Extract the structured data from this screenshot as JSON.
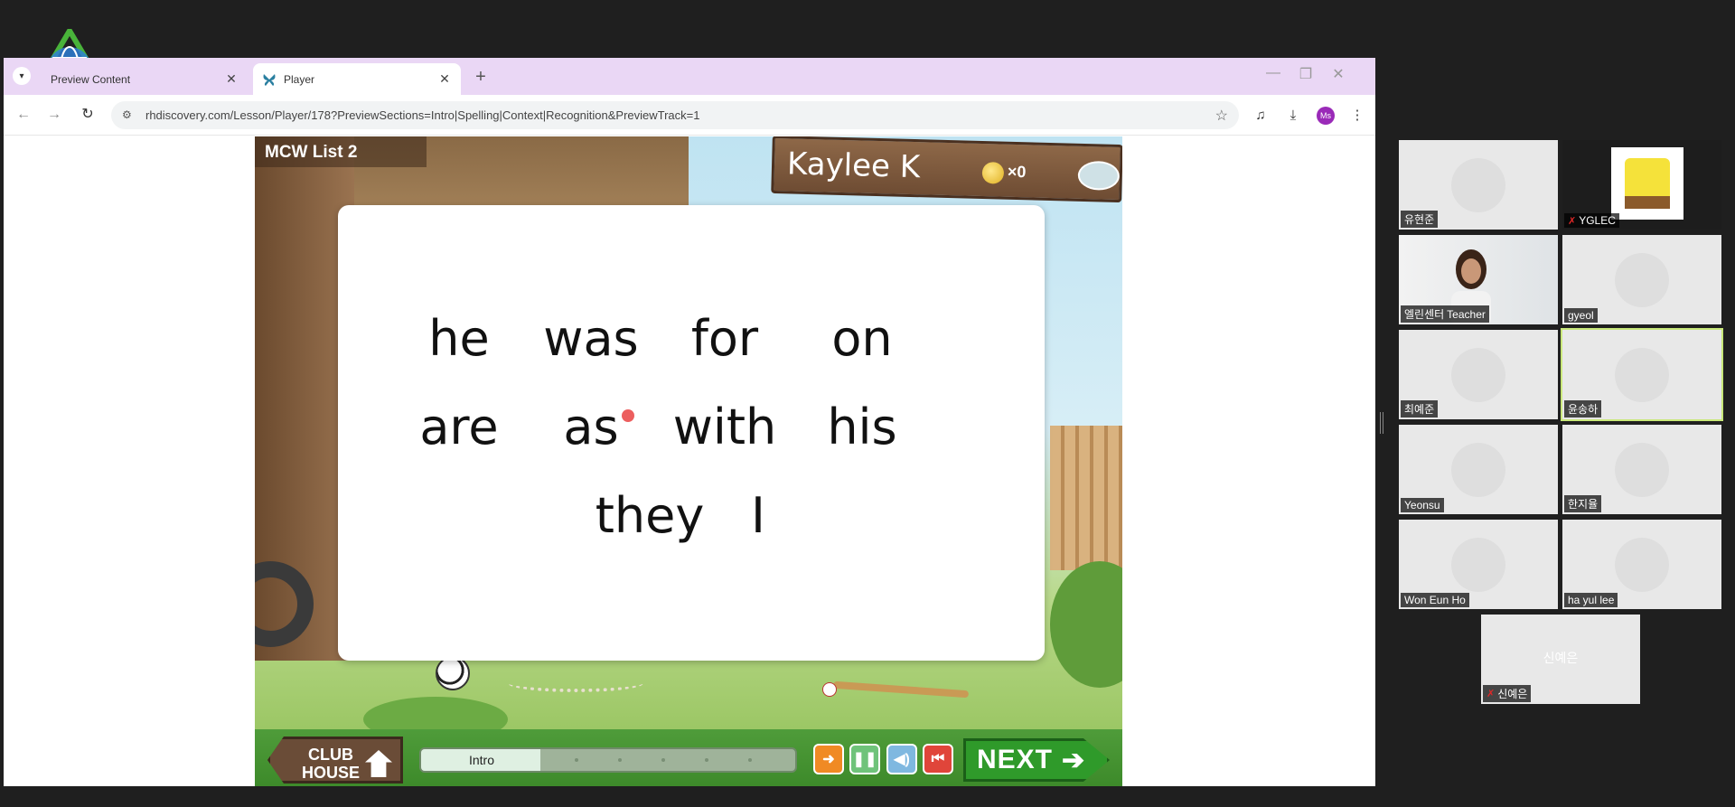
{
  "browser": {
    "tabs": [
      {
        "title": "Preview Content",
        "active": false
      },
      {
        "title": "Player",
        "active": true
      }
    ],
    "url": "rhdiscovery.com/Lesson/Player/178?PreviewSections=Intro|Spelling|Context|Recognition&PreviewTrack=1",
    "profile_initials": "Ms"
  },
  "game": {
    "list_label": "MCW List 2",
    "player_name": "Kaylee K",
    "coin_count": "×0",
    "words": [
      "he",
      "was",
      "for",
      "on",
      "are",
      "as",
      "with",
      "his",
      "they",
      "I"
    ],
    "clubhouse_label": "CLUB HOUSE",
    "section_label": "Intro",
    "section_progress": 0.32,
    "next_label": "NEXT"
  },
  "gallery": {
    "participants": [
      {
        "name": "유현준",
        "muted": false,
        "video": "blurred"
      },
      {
        "name": "YGLEC",
        "muted": true,
        "video": "spongebob"
      },
      {
        "name": "엘린센터",
        "extra": "Teacher",
        "muted": false,
        "video": "teacher"
      },
      {
        "name": "gyeol",
        "muted": false,
        "video": "blurred"
      },
      {
        "name": "최예준",
        "muted": false,
        "video": "blurred"
      },
      {
        "name": "윤송하",
        "muted": false,
        "video": "blurred",
        "active_speaker": true
      },
      {
        "name": "Yeonsu",
        "muted": false,
        "video": "blurred"
      },
      {
        "name": "한지율",
        "muted": false,
        "video": "blurred"
      },
      {
        "name": "Won Eun Ho",
        "muted": false,
        "video": "blurred"
      },
      {
        "name": "ha yul lee",
        "muted": false,
        "video": "blurred"
      },
      {
        "name": "신예은",
        "muted": true,
        "video": "off"
      }
    ]
  }
}
